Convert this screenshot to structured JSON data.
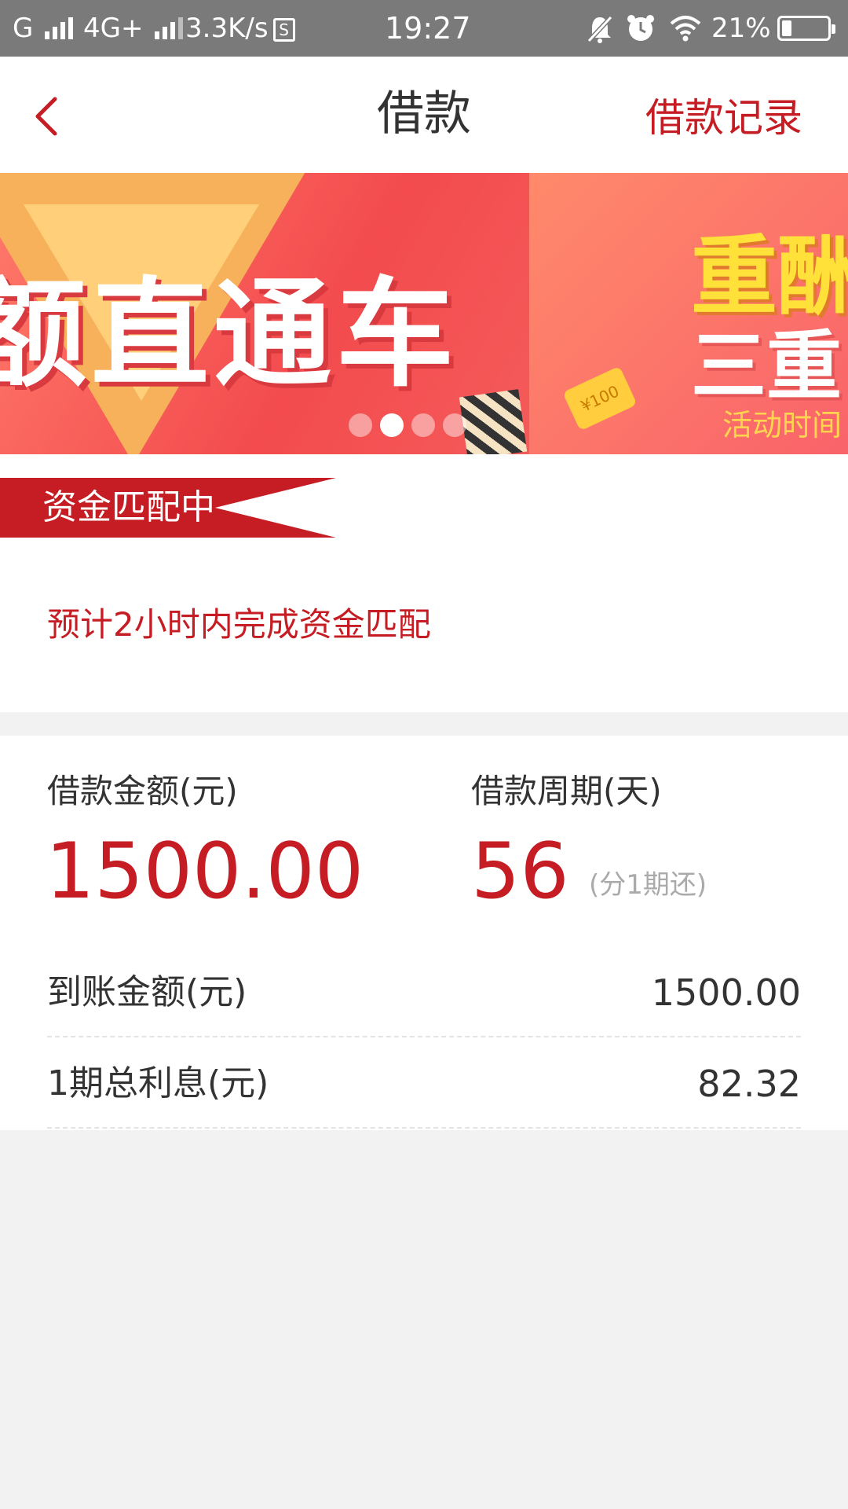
{
  "status_bar": {
    "carrier1": "G",
    "carrier2": "4G+",
    "speed": "3.3K/s",
    "s_badge": "S",
    "time": "19:27",
    "battery": "21%",
    "battery_level": 0.21,
    "icons": [
      "signal-icon",
      "s-badge-icon",
      "mute-bell-icon",
      "alarm-icon",
      "wifi-icon",
      "battery-icon"
    ]
  },
  "header": {
    "title": "借款",
    "records_label": "借款记录",
    "back_icon": "chevron-left-icon"
  },
  "banner": {
    "slide1_text": "额直通车",
    "slide2_line1": "重酬",
    "slide2_line2": "三重",
    "slide2_line3": "活动时间",
    "coin_text": "¥100",
    "dot_count": 4,
    "active_dot": 1
  },
  "match_status": {
    "ribbon": "资金匹配中",
    "eta": "预计2小时内完成资金匹配"
  },
  "loan": {
    "amount_label": "借款金额(元)",
    "amount_value": "1500.00",
    "term_label": "借款周期(天)",
    "term_value": "56",
    "term_note": "(分1期还)",
    "received_label": "到账金额(元)",
    "received_value": "1500.00",
    "interest_label": "1期总利息(元)",
    "interest_value": "82.32"
  },
  "colors": {
    "accent": "#c51d23",
    "status_bar": "#7a7a7a",
    "page_bg": "#f2f2f2"
  }
}
